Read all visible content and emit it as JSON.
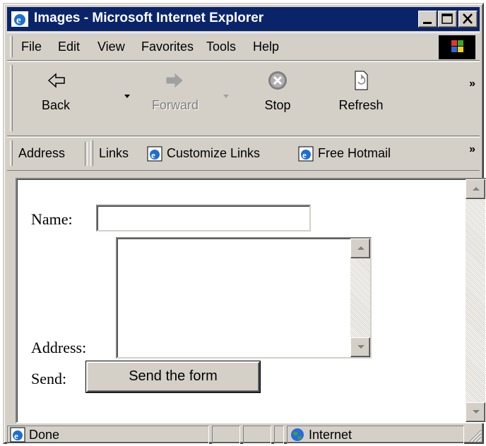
{
  "window": {
    "title": "Images - Microsoft Internet Explorer"
  },
  "menu": [
    {
      "label": "File"
    },
    {
      "label": "Edit"
    },
    {
      "label": "View"
    },
    {
      "label": "Favorites"
    },
    {
      "label": "Tools"
    },
    {
      "label": "Help"
    }
  ],
  "toolbar": {
    "back": "Back",
    "forward": "Forward",
    "stop": "Stop",
    "refresh": "Refresh",
    "more": "»"
  },
  "addressbar": {
    "address": "Address",
    "links": "Links",
    "customize": "Customize Links",
    "hotmail": "Free Hotmail",
    "more": "»"
  },
  "form": {
    "name_label": "Name:",
    "name_value": "",
    "address_label": "Address:",
    "send_label": "Send:",
    "send_button": "Send the form"
  },
  "status": {
    "text": "Done",
    "zone": "Internet"
  }
}
